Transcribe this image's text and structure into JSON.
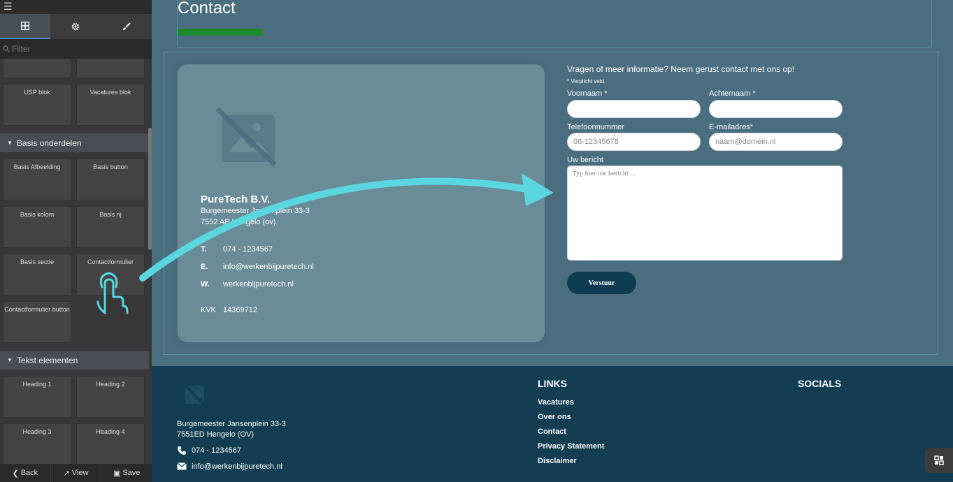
{
  "sidebar": {
    "filter_placeholder": "Filter",
    "blocks_top": [
      "USP blok",
      "Vacatures blok"
    ],
    "sections": [
      {
        "title": "Basis onderdelen",
        "blocks": [
          "Basis Afbeelding",
          "Basis button",
          "Basis kolom",
          "Basis rij",
          "Basis sectie",
          "Contactformulier",
          "Contactformulier button"
        ]
      },
      {
        "title": "Tekst elementen",
        "blocks": [
          "Heading 1",
          "Heading 2",
          "Heading 3",
          "Heading 4"
        ]
      }
    ],
    "footer": {
      "back": "Back",
      "view": "View",
      "save": "Save"
    }
  },
  "page": {
    "title": "Contact",
    "company": {
      "name": "PureTech B.V.",
      "address_line1": "Burgemeester Jansenplein 33-3",
      "address_line2": "7552 AP Hengelo (ov)",
      "phone_key": "T.",
      "phone": "074 - 1234567",
      "email_key": "E.",
      "email": "info@werkenbijpuretech.nl",
      "web_key": "W.",
      "web": "werkenbijpuretech.nl",
      "kvk_key": "KVK",
      "kvk": "14369712"
    },
    "form": {
      "intro": "Vragen of meer informatie? Neem gerust contact met ons op!",
      "required_note": "* Verplicht veld.",
      "first_name_label": "Voornaam *",
      "last_name_label": "Achternaam *",
      "phone_label": "Telefoonnummer",
      "phone_placeholder": "06-12345678",
      "email_label": "E-mailadres*",
      "email_placeholder": "naam@domein.nl",
      "message_label": "Uw bericht",
      "message_placeholder": "Typ hier uw bericht ...",
      "submit_label": "Verstuur"
    }
  },
  "footer": {
    "address_line1": "Burgemeester Jansenplein 33-3",
    "address_line2": "7551ED Hengelo (OV)",
    "phone": "074 - 1234567",
    "email": "info@werkenbijpuretech.nl",
    "links_heading": "LINKS",
    "links": [
      "Vacatures",
      "Over ons",
      "Contact",
      "Privacy Statement",
      "Disclaimer"
    ],
    "socials_heading": "SOCIALS"
  },
  "colors": {
    "accent_arrow": "#5ad6df",
    "green_bar": "#1a8a2a",
    "footer_bg": "#123d52",
    "button_bg": "#0f3c52"
  }
}
